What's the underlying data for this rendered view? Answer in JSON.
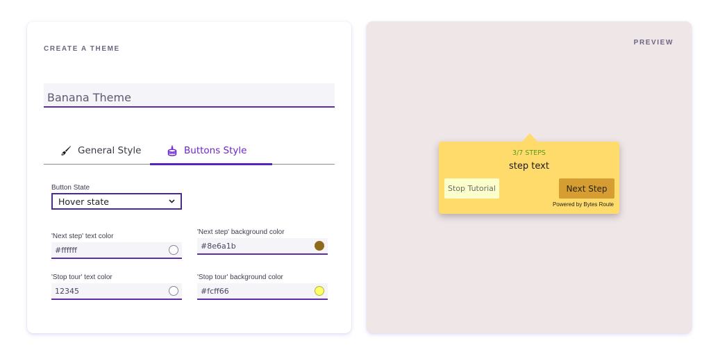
{
  "create_panel": {
    "title": "CREATE A THEME",
    "theme_name": {
      "value": "Banana Theme",
      "placeholder": ""
    },
    "tabs": [
      {
        "label": "General Style",
        "icon": "paint-brush-icon",
        "active": false
      },
      {
        "label": "Buttons Style",
        "icon": "birthday-cake-icon",
        "active": true
      }
    ],
    "button_state": {
      "label": "Button State",
      "selected": "Hover state"
    },
    "fields": {
      "next_text": {
        "label": "'Next step' text color",
        "value": "#ffffff",
        "swatch": "#ffffff"
      },
      "next_bg": {
        "label": "'Next step' background color",
        "value": "#8e6a1b",
        "swatch": "#8e6a1b"
      },
      "stop_text": {
        "label": "'Stop tour' text color",
        "value": "12345",
        "swatch": "#ffffff"
      },
      "stop_bg": {
        "label": "'Stop tour' background color",
        "value": "#fcff66",
        "swatch": "#fcff66"
      }
    }
  },
  "preview_panel": {
    "title": "PREVIEW",
    "tooltip": {
      "steps": "3/7 STEPS",
      "text": "step text",
      "stop_button": "Stop Tutorial",
      "next_button": "Next Step",
      "powered_by": "Powered by Bytes Route",
      "background": "#fedb6b"
    }
  },
  "colors": {
    "accent": "#5b22c2",
    "preview_bg": "#efe6e8"
  }
}
